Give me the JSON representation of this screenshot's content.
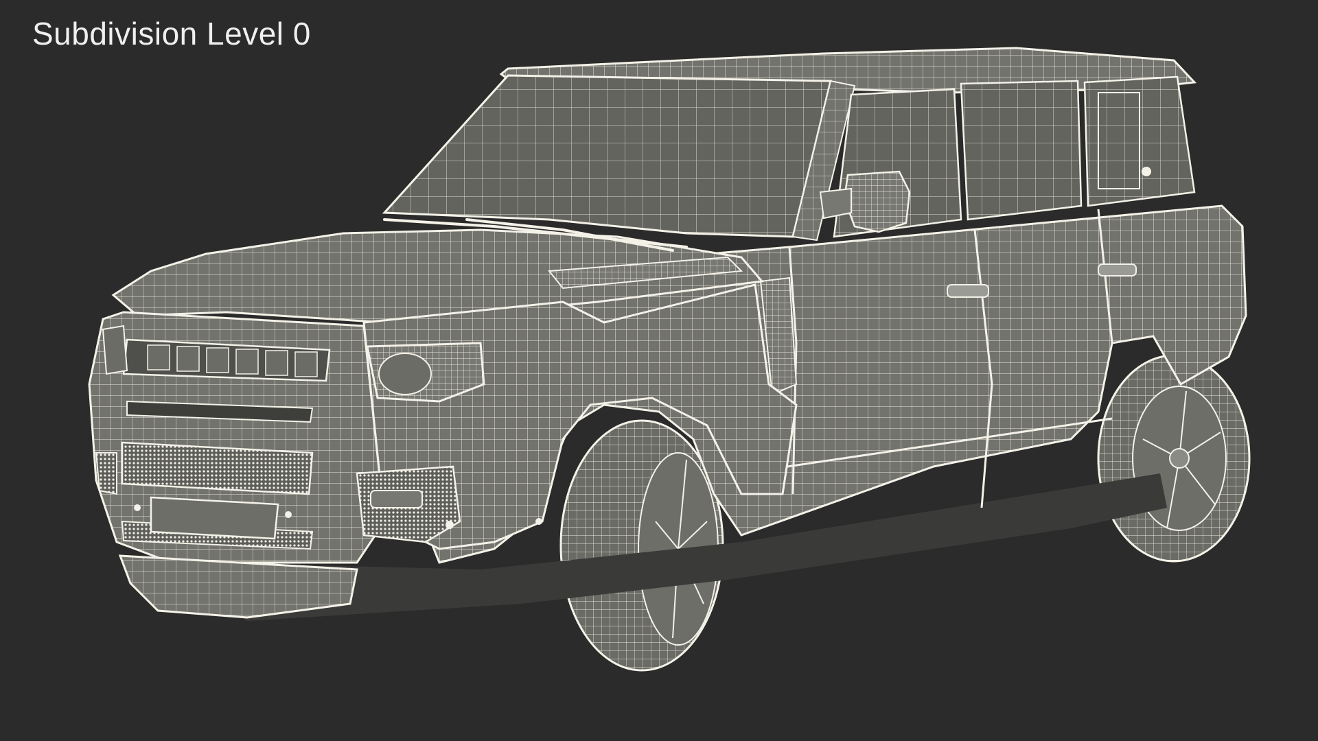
{
  "viewport": {
    "label": "Subdivision Level 0",
    "background_color": "#2b2b2b",
    "wire_color": "#f4f2e8",
    "shade_color": "#6f706a"
  },
  "model": {
    "name": "suv-wireframe-model"
  }
}
